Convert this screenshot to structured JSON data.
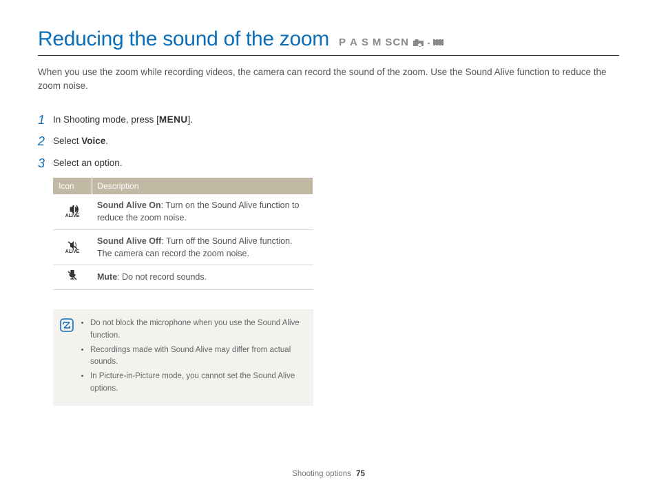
{
  "header": {
    "title": "Reducing the sound of the zoom",
    "modes": [
      "P",
      "A",
      "S",
      "M",
      "SCN"
    ]
  },
  "intro": "When you use the zoom while recording videos, the camera can record the sound of the zoom. Use the Sound Alive function to reduce the zoom noise.",
  "steps": [
    {
      "num": "1",
      "before": "In Shooting mode, press [",
      "menu": "MENU",
      "after": "]."
    },
    {
      "num": "2",
      "before": "Select ",
      "bold": "Voice",
      "after": "."
    },
    {
      "num": "3",
      "before": "Select an option."
    }
  ],
  "table": {
    "h1": "Icon",
    "h2": "Description",
    "rows": [
      {
        "iconLabel": "ALIVE",
        "bold": "Sound Alive On",
        "desc": ": Turn on the Sound Alive function to reduce the zoom noise."
      },
      {
        "iconLabel": "ALIVE",
        "bold": "Sound Alive Off",
        "desc": ": Turn off the Sound Alive function. The camera can record the zoom noise."
      },
      {
        "iconLabel": "",
        "bold": "Mute",
        "desc": ": Do not record sounds."
      }
    ]
  },
  "notes": [
    "Do not block the microphone when you use the Sound Alive function.",
    "Recordings made with Sound Alive may differ from actual sounds.",
    "In Picture-in-Picture mode, you cannot set the Sound Alive options."
  ],
  "footer": {
    "section": "Shooting options",
    "page": "75"
  }
}
